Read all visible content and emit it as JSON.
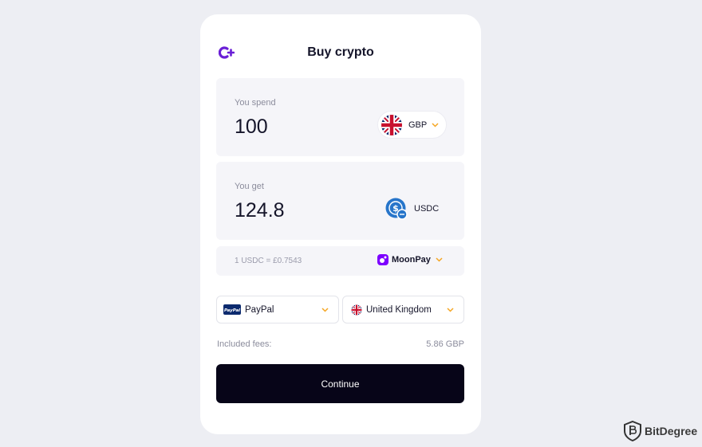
{
  "header": {
    "title": "Buy crypto",
    "logo_icon": "c-plus-logo-icon"
  },
  "spend": {
    "label": "You spend",
    "amount": "100",
    "currency": "GBP",
    "flag_icon": "uk-flag-icon"
  },
  "get": {
    "label": "You get",
    "amount": "124.8",
    "currency": "USDC",
    "coin_icon": "usdc-coin-icon"
  },
  "rate": {
    "text": "1 USDC = £0.7543",
    "provider": "MoonPay",
    "provider_icon": "moonpay-icon"
  },
  "payment": {
    "method": "PayPal",
    "logo_text": "PayPal",
    "country": "United Kingdom"
  },
  "fees": {
    "label": "Included fees:",
    "value": "5.86 GBP"
  },
  "actions": {
    "continue_label": "Continue"
  },
  "watermark": {
    "text": "BitDegree"
  },
  "colors": {
    "accent": "#7b2ff7",
    "chevron": "#f5a623",
    "button": "#070518",
    "background": "#edeef3"
  }
}
